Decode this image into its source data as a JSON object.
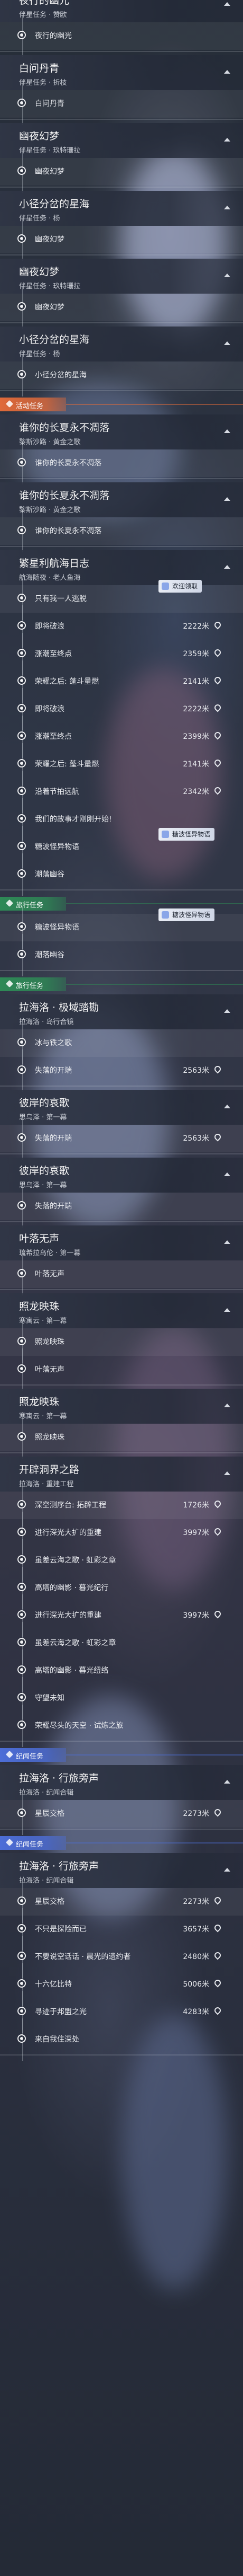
{
  "colors": {
    "mission_world": "#3a4356",
    "event_category": "#e06a3a",
    "companion_category": "#2e8a56",
    "archon_category": "#4d6ed8"
  },
  "missions": [
    {
      "title": "夜行的幽光",
      "subtitle": "伴星任务 · 赞欧",
      "steps": [
        {
          "text": "夜行的幽光",
          "state": "done"
        }
      ]
    },
    {
      "title": "白问丹青",
      "subtitle": "伴星任务 · 折枝",
      "steps": [
        {
          "text": "白问丹青",
          "state": "done"
        }
      ]
    },
    {
      "title": "幽夜幻梦",
      "subtitle": "伴星任务 · 玖特珊拉",
      "steps": [
        {
          "text": "幽夜幻梦",
          "state": "done"
        }
      ]
    },
    {
      "title": "小径分岔的星海",
      "subtitle": "伴星任务 · 杨",
      "steps": [
        {
          "text": "幽夜幻梦",
          "state": "done"
        }
      ]
    },
    {
      "title": "幽夜幻梦",
      "subtitle": "伴星任务 · 玖特珊拉",
      "steps": [
        {
          "text": "幽夜幻梦",
          "state": "done"
        }
      ]
    },
    {
      "title": "小径分岔的星海",
      "subtitle": "伴星任务 · 杨",
      "steps": [
        {
          "text": "小径分岔的星海",
          "state": "done"
        }
      ]
    },
    {
      "category": "活动任务"
    },
    {
      "title": "谁你的长夏永不凋落",
      "subtitle": "黎斯沙路 · 黄金之歌",
      "steps": [
        {
          "text": "谁你的长夏永不凋落",
          "state": "done"
        }
      ]
    },
    {
      "title": "谁你的长夏永不凋落",
      "subtitle": "黎斯沙路 · 黄金之歌",
      "steps": [
        {
          "text": "谁你的长夏永不凋落",
          "state": "done"
        }
      ]
    },
    {
      "title": "繁星利航海日志",
      "subtitle": "航海随夜 · 老人鱼海",
      "steps": [
        {
          "text": "只有我一人逃脱",
          "state": "done",
          "badge": "欢迎领取"
        },
        {
          "text": "即将破浪",
          "state": "done",
          "dist": "2222米"
        },
        {
          "text": "涨潮至终点",
          "state": "done",
          "dist": "2359米"
        },
        {
          "text": "荣耀之后: 蓬斗量燃",
          "state": "done",
          "dist": "2141米"
        },
        {
          "text": "即将破浪",
          "state": "done",
          "dist": "2222米"
        },
        {
          "text": "涨潮至终点",
          "state": "done",
          "dist": "2399米"
        },
        {
          "text": "荣耀之后: 蓬斗量燃",
          "state": "done",
          "dist": "2141米"
        },
        {
          "text": "沿着节拍远航",
          "state": "done",
          "dist": "2342米"
        },
        {
          "text": "我们的故事才刚刚开始!",
          "state": "done"
        },
        {
          "text": "糖波怪异物语",
          "state": "done",
          "badge": "糖波怪异物语"
        },
        {
          "text": "潮落幽谷",
          "state": "done"
        }
      ]
    },
    {
      "category": "旅行任务"
    },
    {
      "steps": [
        {
          "text": "糖波怪异物语",
          "state": "done",
          "badge": "糖波怪异物语"
        },
        {
          "text": "潮落幽谷",
          "state": "done"
        }
      ]
    },
    {
      "category": "旅行任务"
    },
    {
      "title": "拉海洛 · 极域踏勘",
      "subtitle": "拉海洛 · 岛行合镜",
      "steps": [
        {
          "text": "冰与铁之歌",
          "state": "done"
        },
        {
          "text": "失落的开端",
          "state": "done",
          "dist": "2563米"
        }
      ]
    },
    {
      "title": "彼岸的哀歌",
      "subtitle": "思乌泽 · 第一幕",
      "steps": [
        {
          "text": "失落的开端",
          "state": "done",
          "dist": "2563米"
        }
      ]
    },
    {
      "title": "彼岸的哀歌",
      "subtitle": "思乌泽 · 第一幕",
      "steps": [
        {
          "text": "失落的开端",
          "state": "done"
        }
      ]
    },
    {
      "title": "叶落无声",
      "subtitle": "琉希拉乌伦 · 第一幕",
      "steps": [
        {
          "text": "叶落无声",
          "state": "done"
        }
      ]
    },
    {
      "title": "照龙映珠",
      "subtitle": "寒寓云 · 第一幕",
      "steps": [
        {
          "text": "照龙映珠",
          "state": "done"
        },
        {
          "text": "叶落无声",
          "state": "done"
        }
      ]
    },
    {
      "title": "照龙映珠",
      "subtitle": "寒寓云 · 第一幕",
      "steps": [
        {
          "text": "照龙映珠",
          "state": "done"
        }
      ]
    },
    {
      "title": "开辟洞界之路",
      "subtitle": "拉海洛 · 重建工程",
      "steps": [
        {
          "text": "深空测序台: 拓辟工程",
          "state": "done",
          "dist": "1726米"
        },
        {
          "text": "进行深光大扩的重建",
          "state": "done",
          "dist": "3997米"
        },
        {
          "text": "虽差云海之歌 · 虹彩之章",
          "state": "done"
        },
        {
          "text": "高塔的幽影 · 暮光纪行",
          "state": "done"
        },
        {
          "text": "进行深光大扩的重建",
          "state": "done",
          "dist": "3997米"
        },
        {
          "text": "虽差云海之歌 · 虹彩之章",
          "state": "done"
        },
        {
          "text": "高塔的幽影 · 暮光纽络",
          "state": "done"
        },
        {
          "text": "守望未知",
          "state": "done"
        },
        {
          "text": "荣耀尽头的天空 · 试炼之旅",
          "state": "done"
        }
      ]
    },
    {
      "category": "纪闻任务"
    },
    {
      "title": "拉海洛 · 行旅旁声",
      "subtitle": "拉海洛 · 纪闻合辑",
      "steps": [
        {
          "text": "星辰交格",
          "state": "done",
          "dist": "2273米"
        }
      ]
    },
    {
      "category": "纪闻任务"
    },
    {
      "title": "拉海洛 · 行旅旁声",
      "subtitle": "拉海洛 · 纪闻合辑",
      "steps": [
        {
          "text": "星辰交格",
          "state": "done",
          "dist": "2273米"
        },
        {
          "text": "不只是探险而已",
          "state": "done",
          "dist": "3657米"
        },
        {
          "text": "不要说空话话 · 晨光的遗约者",
          "state": "done",
          "dist": "2480米"
        },
        {
          "text": "十六亿比特",
          "state": "done",
          "dist": "5006米"
        },
        {
          "text": "寻迹于邦盟之光",
          "state": "done",
          "dist": "4283米"
        },
        {
          "text": "来自我住深处",
          "state": "done"
        }
      ]
    }
  ]
}
